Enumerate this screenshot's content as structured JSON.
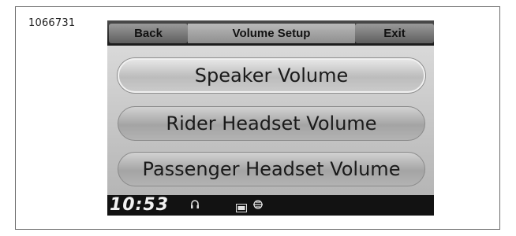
{
  "figure_id": "1066731",
  "screen": {
    "header": {
      "back_label": "Back",
      "title": "Volume Setup",
      "exit_label": "Exit"
    },
    "menu": {
      "items": [
        {
          "label": "Speaker Volume",
          "selected": true
        },
        {
          "label": "Rider Headset Volume",
          "selected": false
        },
        {
          "label": "Passenger Headset Volume",
          "selected": false
        }
      ]
    },
    "status": {
      "time": "10:53",
      "icons": [
        "headset-icon",
        "int-icon",
        "motorcycle-icon"
      ]
    }
  }
}
